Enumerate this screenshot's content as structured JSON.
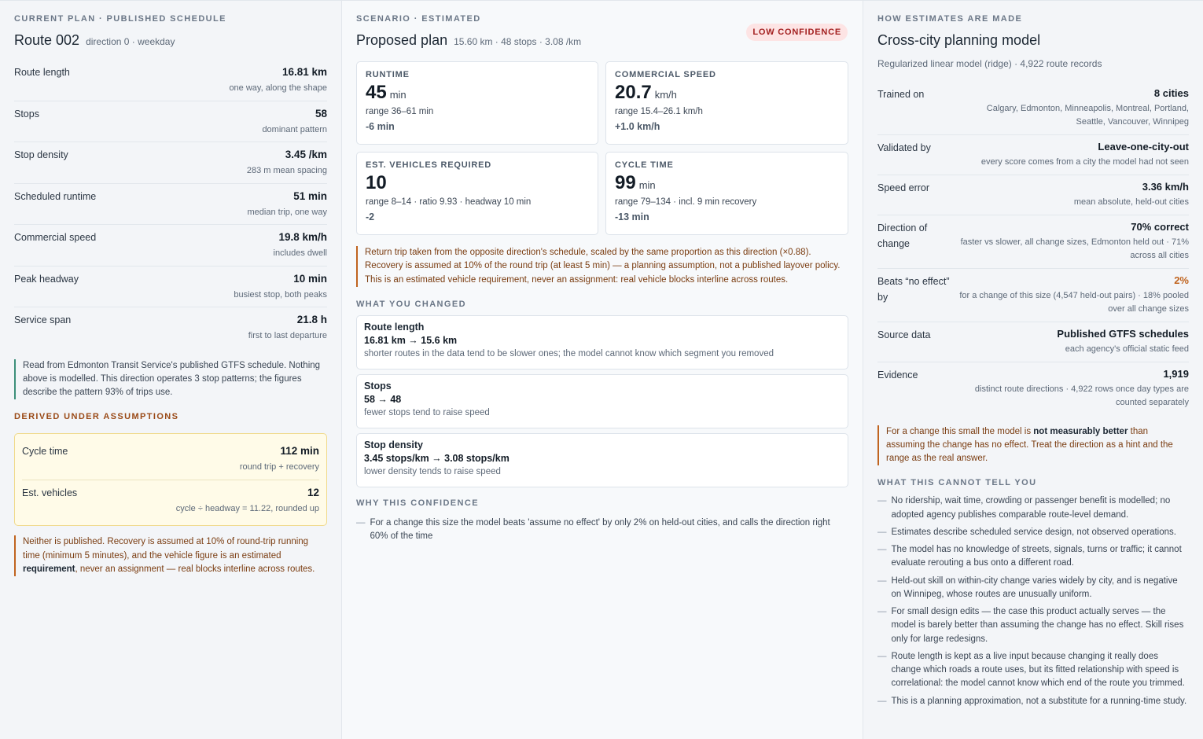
{
  "current": {
    "eyebrow": "CURRENT PLAN · PUBLISHED SCHEDULE",
    "title": "Route 002",
    "subtitle": "direction 0 · weekday",
    "metrics": [
      {
        "label": "Route length",
        "value": "16.81 km",
        "note": "one way, along the shape"
      },
      {
        "label": "Stops",
        "value": "58",
        "note": "dominant pattern"
      },
      {
        "label": "Stop density",
        "value": "3.45 /km",
        "note": "283 m mean spacing"
      },
      {
        "label": "Scheduled runtime",
        "value": "51 min",
        "note": "median trip, one way"
      },
      {
        "label": "Commercial speed",
        "value": "19.8 km/h",
        "note": "includes dwell"
      },
      {
        "label": "Peak headway",
        "value": "10 min",
        "note": "busiest stop, both peaks"
      },
      {
        "label": "Service span",
        "value": "21.8 h",
        "note": "first to last departure"
      }
    ],
    "source_note": "Read from Edmonton Transit Service's published GTFS schedule. Nothing above is modelled. This direction operates 3 stop patterns; the figures describe the pattern 93% of trips use.",
    "derived_eyebrow": "DERIVED UNDER ASSUMPTIONS",
    "derived": [
      {
        "label": "Cycle time",
        "value": "112 min",
        "note": "round trip + recovery"
      },
      {
        "label": "Est. vehicles",
        "value": "12",
        "note": "cycle ÷ headway = 11.22, rounded up"
      }
    ],
    "derived_note_a": "Neither is published. Recovery is assumed at 10% of round-trip running time (minimum 5 minutes), and the vehicle figure is an estimated ",
    "derived_note_bold": "requirement",
    "derived_note_b": ", never an assignment — real blocks interline across routes."
  },
  "scenario": {
    "eyebrow": "SCENARIO · ESTIMATED",
    "title": "Proposed plan",
    "subtitle": "15.60 km · 48 stops · 3.08 /km",
    "badge": "LOW CONFIDENCE",
    "cards": [
      {
        "label": "RUNTIME",
        "value": "45",
        "unit": "min",
        "range": "range 36–61 min",
        "delta": "-6 min"
      },
      {
        "label": "COMMERCIAL SPEED",
        "value": "20.7",
        "unit": "km/h",
        "range": "range 15.4–26.1 km/h",
        "delta": "+1.0 km/h"
      },
      {
        "label": "EST. VEHICLES REQUIRED",
        "value": "10",
        "unit": "",
        "range": "range 8–14 · ratio 9.93 · headway 10 min",
        "delta": "-2"
      },
      {
        "label": "CYCLE TIME",
        "value": "99",
        "unit": "min",
        "range": "range 79–134 · incl. 9 min recovery",
        "delta": "-13 min"
      }
    ],
    "warning": "Return trip taken from the opposite direction's schedule, scaled by the same proportion as this direction (×0.88). Recovery is assumed at 10% of the round trip (at least 5 min) — a planning assumption, not a published layover policy. This is an estimated vehicle requirement, never an assignment: real vehicle blocks interline across routes.",
    "changed_eyebrow": "WHAT YOU CHANGED",
    "changes": [
      {
        "label": "Route length",
        "value": "16.81 km → 15.6 km",
        "note": "shorter routes in the data tend to be slower ones; the model cannot know which segment you removed"
      },
      {
        "label": "Stops",
        "value": "58 → 48",
        "note": "fewer stops tend to raise speed"
      },
      {
        "label": "Stop density",
        "value": "3.45 stops/km → 3.08 stops/km",
        "note": "lower density tends to raise speed"
      }
    ],
    "why_eyebrow": "WHY THIS CONFIDENCE",
    "why": [
      "For a change this size the model beats 'assume no effect' by only 2% on held-out cities, and calls the direction right 60% of the time"
    ]
  },
  "model": {
    "eyebrow": "HOW ESTIMATES ARE MADE",
    "title": "Cross-city planning model",
    "subtitle": "Regularized linear model (ridge) · 4,922 route records",
    "rows": [
      {
        "label": "Trained on",
        "value": "8 cities",
        "note": "Calgary, Edmonton, Minneapolis, Montreal, Portland, Seattle, Vancouver, Winnipeg"
      },
      {
        "label": "Validated by",
        "value": "Leave-one-city-out",
        "note": "every score comes from a city the model had not seen"
      },
      {
        "label": "Speed error",
        "value": "3.36 km/h",
        "note": "mean absolute, held-out cities"
      },
      {
        "label": "Direction of change",
        "value": "70% correct",
        "note": "faster vs slower, all change sizes, Edmonton held out · 71% across all cities"
      },
      {
        "label": "Beats “no effect” by",
        "value": "2%",
        "note": "for a change of this size (4,547 held-out pairs) · 18% pooled over all change sizes"
      },
      {
        "label": "Source data",
        "value": "Published GTFS schedules",
        "note": "each agency's official static feed"
      },
      {
        "label": "Evidence",
        "value": "1,919",
        "note": "distinct route directions · 4,922 rows once day types are counted separately"
      }
    ],
    "caution_a": "For a change this small the model is ",
    "caution_bold": "not measurably better",
    "caution_b": " than assuming the change has no effect. Treat the direction as a hint and the range as the real answer.",
    "cannot_eyebrow": "WHAT THIS CANNOT TELL YOU",
    "cannot": [
      "No ridership, wait time, crowding or passenger benefit is modelled; no adopted agency publishes comparable route-level demand.",
      "Estimates describe scheduled service design, not observed operations.",
      "The model has no knowledge of streets, signals, turns or traffic; it cannot evaluate rerouting a bus onto a different road.",
      "Held-out skill on within-city change varies widely by city, and is negative on Winnipeg, whose routes are unusually uniform.",
      "For small design edits — the case this product actually serves — the model is barely better than assuming the change has no effect. Skill rises only for large redesigns.",
      "Route length is kept as a live input because changing it really does change which roads a route uses, but its fitted relationship with speed is correlational: the model cannot know which end of the route you trimmed.",
      "This is a planning approximation, not a substitute for a running-time study."
    ],
    "dash": "—"
  },
  "colors": {
    "accent_warm": "#c0641f",
    "badge_bg": "#fde4e4",
    "badge_text": "#a32020",
    "assume_bg": "#fffbe8",
    "note_green": "#3c8f7a"
  }
}
